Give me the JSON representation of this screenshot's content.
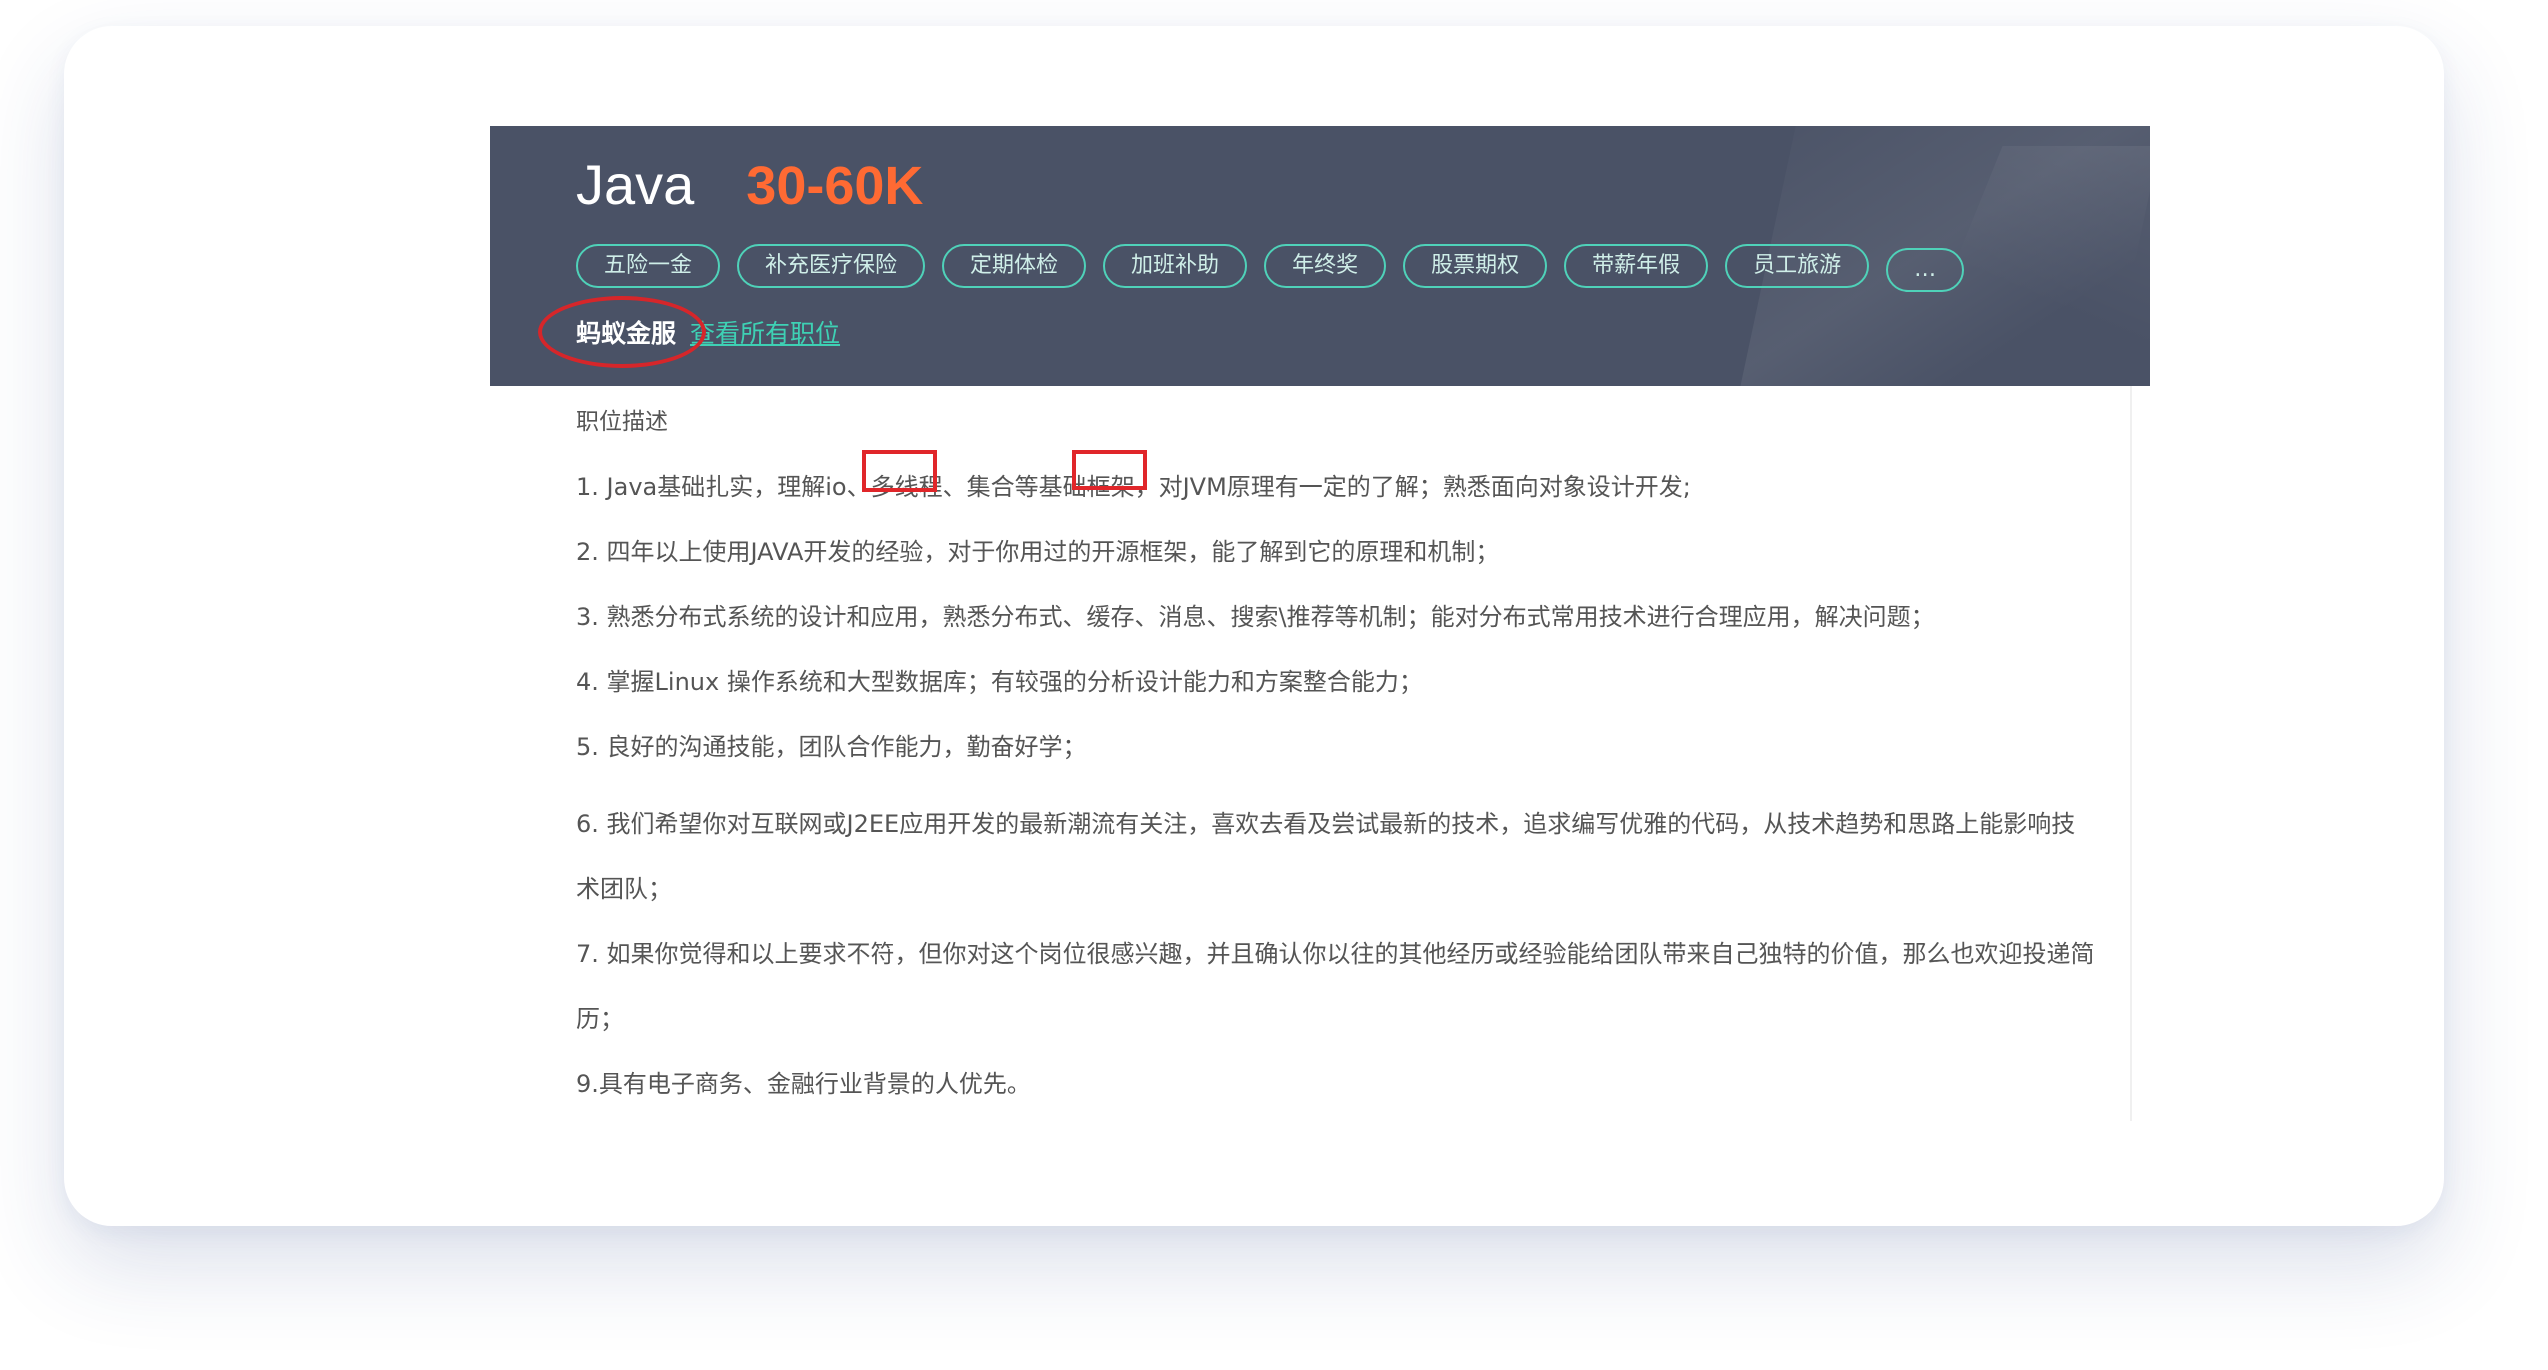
{
  "job": {
    "title": "Java",
    "salary": "30-60K",
    "benefits": [
      "五险一金",
      "补充医疗保险",
      "定期体检",
      "加班补助",
      "年终奖",
      "股票期权",
      "带薪年假",
      "员工旅游"
    ],
    "more_label": "…",
    "company": "蚂蚁金服",
    "view_all_label": "查看所有职位"
  },
  "description": {
    "section_title": "职位描述",
    "requirements": [
      "1. Java基础扎实，理解io、多线程、集合等基础框架，对JVM原理有一定的了解；熟悉面向对象设计开发;",
      "2. 四年以上使用JAVA开发的经验，对于你用过的开源框架，能了解到它的原理和机制；",
      "3. 熟悉分布式系统的设计和应用，熟悉分布式、缓存、消息、搜索\\推荐等机制；能对分布式常用技术进行合理应用，解决问题；",
      "4. 掌握Linux 操作系统和大型数据库；有较强的分析设计能力和方案整合能力；",
      "5. 良好的沟通技能，团队合作能力，勤奋好学；",
      "6. 我们希望你对互联网或J2EE应用开发的最新潮流有关注，喜欢去看及尝试最新的技术，追求编写优雅的代码，从技术趋势和思路上能影响技术团队；",
      "7. 如果你觉得和以上要求不符，但你对这个岗位很感兴趣，并且确认你以往的其他经历或经验能给团队带来自己独特的价值，那么也欢迎投递简历；",
      "9.具有电子商务、金融行业背景的人优先。"
    ]
  },
  "annotations": {
    "color": "#e0262a"
  }
}
